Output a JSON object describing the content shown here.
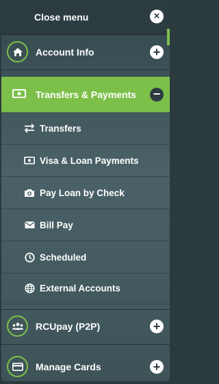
{
  "menu": {
    "close_label": "Close menu",
    "close_icon": "×"
  },
  "items": [
    {
      "label": "Account Info",
      "icon": "home-icon",
      "state": "collapsed",
      "toggle": "+"
    },
    {
      "label": "Transfers & Payments",
      "icon": "money-icon",
      "state": "expanded",
      "toggle": "−"
    },
    {
      "label": "RCUpay (P2P)",
      "icon": "users-icon",
      "state": "collapsed",
      "toggle": "+"
    },
    {
      "label": "Manage Cards",
      "icon": "card-icon",
      "state": "collapsed",
      "toggle": "+"
    }
  ],
  "subitems": [
    {
      "label": "Transfers",
      "icon": "arrows-icon"
    },
    {
      "label": "Visa & Loan Payments",
      "icon": "money-icon"
    },
    {
      "label": "Pay Loan by Check",
      "icon": "camera-icon"
    },
    {
      "label": "Bill Pay",
      "icon": "envelope-icon"
    },
    {
      "label": "Scheduled",
      "icon": "clock-icon"
    },
    {
      "label": "External Accounts",
      "icon": "globe-icon"
    }
  ],
  "colors": {
    "accent": "#7cc04a",
    "background": "#3d5358",
    "text": "#ffffff"
  }
}
